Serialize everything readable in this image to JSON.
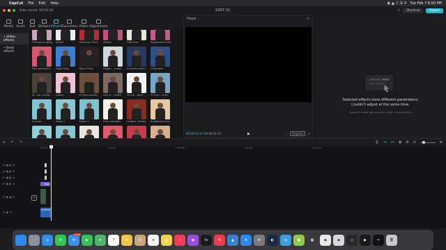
{
  "mac_menu": {
    "apple_glyph": "",
    "app_name": "CapCut",
    "items": [
      "File",
      "Edit",
      "Help"
    ],
    "datetime": "Tue Feb 7  6:50 PM"
  },
  "window": {
    "autosave": "Auto saved: 18:50:20",
    "title": "0207 (1)",
    "shortcut_label": "Shortcut",
    "export_label": "Export"
  },
  "toolbar": {
    "tools": [
      {
        "label": "Media",
        "icon": "media-icon"
      },
      {
        "label": "Audio",
        "icon": "audio-icon"
      },
      {
        "label": "Text",
        "icon": "text-icon"
      },
      {
        "label": "Stickers",
        "icon": "stickers-icon"
      },
      {
        "label": "Effects",
        "icon": "effects-icon"
      },
      {
        "label": "Transitions",
        "icon": "transitions-icon"
      },
      {
        "label": "Filters",
        "icon": "filters-icon"
      },
      {
        "label": "Adjustment",
        "icon": "adjustment-icon"
      }
    ],
    "active": "Effects"
  },
  "sidebar": {
    "items": [
      "• Video effects",
      "• Body effects"
    ],
    "selected": "• Video effects"
  },
  "effects": [
    {
      "label": "Pinkround swing",
      "bg": "#c9a3b8"
    },
    {
      "label": "Shake",
      "bg": "#e9eef2"
    },
    {
      "label": "Vibration Flash",
      "bg": "#b42a3a"
    },
    {
      "label": "Strobe",
      "bg": "#c94b78"
    },
    {
      "label": "Halo Blur",
      "bg": "#e8e3dc"
    },
    {
      "label": "Randomize frame",
      "bg": "#c25a8a"
    },
    {
      "label": "Play pendulum",
      "bg": "#d6586e"
    },
    {
      "label": "Edge Glow",
      "bg": "#3a7fd6"
    },
    {
      "label": "Black Flash",
      "bg": "#2a2025"
    },
    {
      "label": "Ripple ...urban",
      "bg": "#cfd7dc"
    },
    {
      "label": "Extreme vision",
      "bg": "#243a62"
    },
    {
      "label": "Chromatic",
      "bg": "#2b4f88"
    },
    {
      "label": "Sc. Fle...ionize",
      "bg": "#4a4238"
    },
    {
      "label": "Gleam",
      "bg": "#f0c0d4"
    },
    {
      "label": "Printed quality",
      "bg": "#6d4f3c"
    },
    {
      "label": "Dot Gr... Video",
      "bg": "#7f6a62"
    },
    {
      "label": "Dis Sk...blind",
      "bg": "#f0f2f4"
    },
    {
      "label": "TV Col... Lines",
      "bg": "#74a6c8"
    },
    {
      "label": "Scanlen",
      "bg": "#7dc4d6"
    },
    {
      "label": "Noise 2",
      "bg": "#86c9d4"
    },
    {
      "label": "Noise 1",
      "bg": "#7cc3d2"
    },
    {
      "label": "Fault cassette",
      "bg": "#f2efe9"
    },
    {
      "label": "Hinged...stroke",
      "bg": "#8a2a1f"
    },
    {
      "label": "Radiating Lines",
      "bg": "#e7c8a0"
    },
    {
      "label": "",
      "bg": "#8ed0da"
    },
    {
      "label": "",
      "bg": "#83c6d4"
    },
    {
      "label": "",
      "bg": "#e9e6e0"
    },
    {
      "label": "",
      "bg": "#e25a6a"
    },
    {
      "label": "",
      "bg": "#c83a4a"
    },
    {
      "label": "",
      "bg": "#d8b090"
    }
  ],
  "player": {
    "title": "Player",
    "current_time": "00:00:21:07",
    "total_time": "00:00:21:07",
    "ratio_label": "Original"
  },
  "properties": {
    "message_line1": "Selected effects have different parameters.",
    "message_line2": "Couldn't adjust at the same time.",
    "sub_message": "Couldn't make adjustment under current status"
  },
  "timeline": {
    "ruler": [
      "00:00",
      "| 00:20",
      "| 00:40",
      "| 01:00",
      "| 01:20"
    ],
    "clip_label": "Lap",
    "audio_label": "original"
  },
  "dock": {
    "apps": [
      {
        "name": "Finder",
        "bg": "#2a8df3",
        "glyph": ""
      },
      {
        "name": "Launchpad",
        "bg": "#8a8fa0",
        "glyph": "⋮⋮"
      },
      {
        "name": "Safari",
        "bg": "#2d8ef0",
        "glyph": "◎"
      },
      {
        "name": "Messages",
        "bg": "#2fc84f",
        "glyph": "✉",
        "badge": ""
      },
      {
        "name": "Mail",
        "bg": "#3a8ff2",
        "glyph": "✉",
        "badge": "1,232"
      },
      {
        "name": "FaceTime",
        "bg": "#35c15b",
        "glyph": "▶"
      },
      {
        "name": "Maps",
        "bg": "#4fb56a",
        "glyph": "➤"
      },
      {
        "name": "Calendar",
        "bg": "#ffffff",
        "glyph": "7"
      },
      {
        "name": "Photos",
        "bg": "#f4c542",
        "glyph": "✿"
      },
      {
        "name": "Contacts",
        "bg": "#c8a878",
        "glyph": "☺"
      },
      {
        "name": "Reminders",
        "bg": "#f5f5f5",
        "glyph": "≡"
      },
      {
        "name": "Notes",
        "bg": "#f4d34a",
        "glyph": "▤"
      },
      {
        "name": "Music",
        "bg": "#f53b57",
        "glyph": "♪"
      },
      {
        "name": "Podcasts",
        "bg": "#9b4ede",
        "glyph": "◉"
      },
      {
        "name": "TV",
        "bg": "#1a1a1a",
        "glyph": "tv"
      },
      {
        "name": "News",
        "bg": "#f23a4a",
        "glyph": "N"
      },
      {
        "name": "Keynote",
        "bg": "#3a7fd0",
        "glyph": "▲"
      },
      {
        "name": "App Store",
        "bg": "#2b8bf0",
        "glyph": "A"
      },
      {
        "name": "System Preferences",
        "bg": "#7a7a80",
        "glyph": "⚙"
      },
      {
        "name": "Steam",
        "bg": "#1b2a44",
        "glyph": "◐"
      },
      {
        "name": "Browser",
        "bg": "#3aa0e0",
        "glyph": "◎"
      },
      {
        "name": "CapCut Editor",
        "bg": "#8fc84a",
        "glyph": "▣"
      },
      {
        "name": "Screen Tool",
        "bg": "#3a3a3a",
        "glyph": "▦"
      },
      {
        "name": "Chrome",
        "bg": "#e8e8e8",
        "glyph": "◉"
      },
      {
        "name": "Roblox",
        "bg": "#d8d8d8",
        "glyph": "◆"
      },
      {
        "name": "Roblox Studio",
        "bg": "#2a2a2a",
        "glyph": "◇"
      },
      {
        "name": "Play",
        "bg": "#1a1a1a",
        "glyph": "▶"
      },
      {
        "name": "CapCut",
        "bg": "#111111",
        "glyph": "✂"
      },
      {
        "name": "Trash",
        "bg": "#c9c9cc",
        "glyph": "🗑"
      }
    ]
  },
  "colors": {
    "accent": "#3fc4d4",
    "export": "#22b8cf",
    "clip_purple": "#7b5fd9",
    "clip_blue": "#2a66b8"
  }
}
